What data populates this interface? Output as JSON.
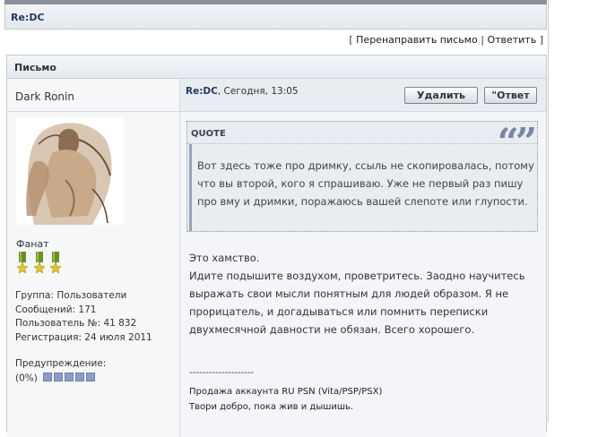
{
  "header": {
    "title": "Re:DC"
  },
  "actions": {
    "forward": "Перенаправить письмо",
    "reply": "Ответить",
    "open": "[",
    "sep": "|",
    "close": "]"
  },
  "post_panel": {
    "label": "Письмо"
  },
  "author": {
    "name": "Dark Ronin",
    "rank": "Фанат",
    "group": "Группа: Пользователи",
    "messages": "Сообщений: 171",
    "user_no": "Пользователь №: 41 832",
    "registered": "Регистрация: 24 июля 2011",
    "warning_label": "Предупреждение:",
    "warning_value": "(0%)"
  },
  "post": {
    "title": "Re:DC",
    "time": ", Сегодня, 13:05",
    "delete_label": "Удалить",
    "reply_label": "\"Ответ",
    "quote_label": "QUOTE",
    "quote_mark": "“”",
    "quote_text": "Вот здесь тоже про дримку, ссыль не скопировалась, потому что вы второй, кого я спрашиваю. Уже не первый раз пишу про вму и дримки, поражаюсь вашей слепоте или глупости.",
    "body_lines": [
      "Это хамство.",
      "Идите подышите воздухом, проветритесь. Заодно научитесь выражать свои мысли понятным для людей образом. Я не прорицатель, и догадываться или помнить переписки двухмесячной давности не обязан. Всего хорошего."
    ],
    "sig_separator": "--------------------",
    "signature_line1": "Продажа аккаунта RU PSN (Vita/PSP/PSX)",
    "signature_line2": "Твори добро, пока жив и дышишь."
  },
  "colors": {
    "accent": "#1f3a5f",
    "warning_box": "#8c9bc7",
    "medal_green": "#6b8f2a",
    "medal_star": "#e6c51e"
  }
}
